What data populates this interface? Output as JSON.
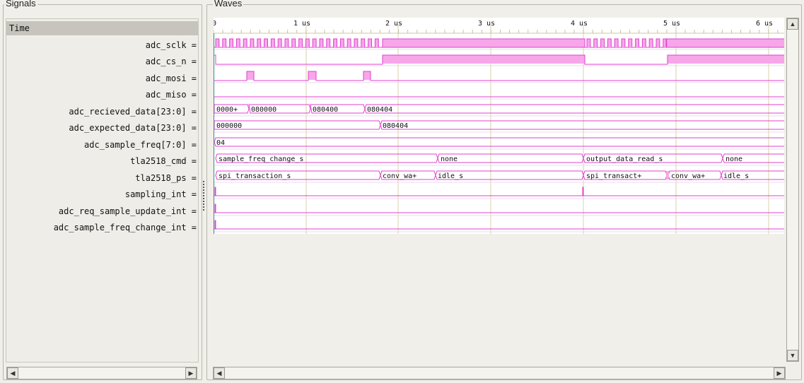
{
  "panels": {
    "signals_title": "Signals",
    "waves_title": "Waves"
  },
  "signals": {
    "time_label": "Time",
    "rows": [
      "adc_sclk =",
      "adc_cs_n =",
      "adc_mosi =",
      "adc_miso =",
      "adc_recieved_data[23:0] =",
      "adc_expected_data[23:0] =",
      "adc_sample_freq[7:0] =",
      "tla2518_cmd =",
      "tla2518_ps =",
      "sampling_int =",
      "adc_req_sample_update_int =",
      "adc_sample_freq_change_int ="
    ]
  },
  "timeline": {
    "start_label": "0",
    "ticks": [
      "1 us",
      "2 us",
      "3 us",
      "4 us",
      "5 us",
      "6 us"
    ]
  },
  "buses": {
    "recieved": [
      "0000+",
      "080000",
      "080400",
      "080404"
    ],
    "expected": [
      "000000",
      "080404"
    ],
    "sample_freq": [
      "04"
    ],
    "cmd": [
      "sample_freq_change_s",
      "none",
      "output_data_read_s",
      "none"
    ],
    "ps": [
      "spi_transaction_s",
      "conv_wa+",
      "idle_s",
      "spi_transact+",
      "conv_wa+",
      "idle_s"
    ]
  },
  "colors": {
    "wave_trace": "#e040d0",
    "wave_fill": "#f7a6ea",
    "grid_line": "#d8d2a8",
    "panel_bg": "#f0efe9",
    "wave_bg": "#ffffff"
  },
  "scroll": {
    "left_icon": "arrow-left-icon",
    "right_icon": "arrow-right-icon",
    "up_icon": "arrow-up-icon",
    "down_icon": "arrow-down-icon"
  }
}
